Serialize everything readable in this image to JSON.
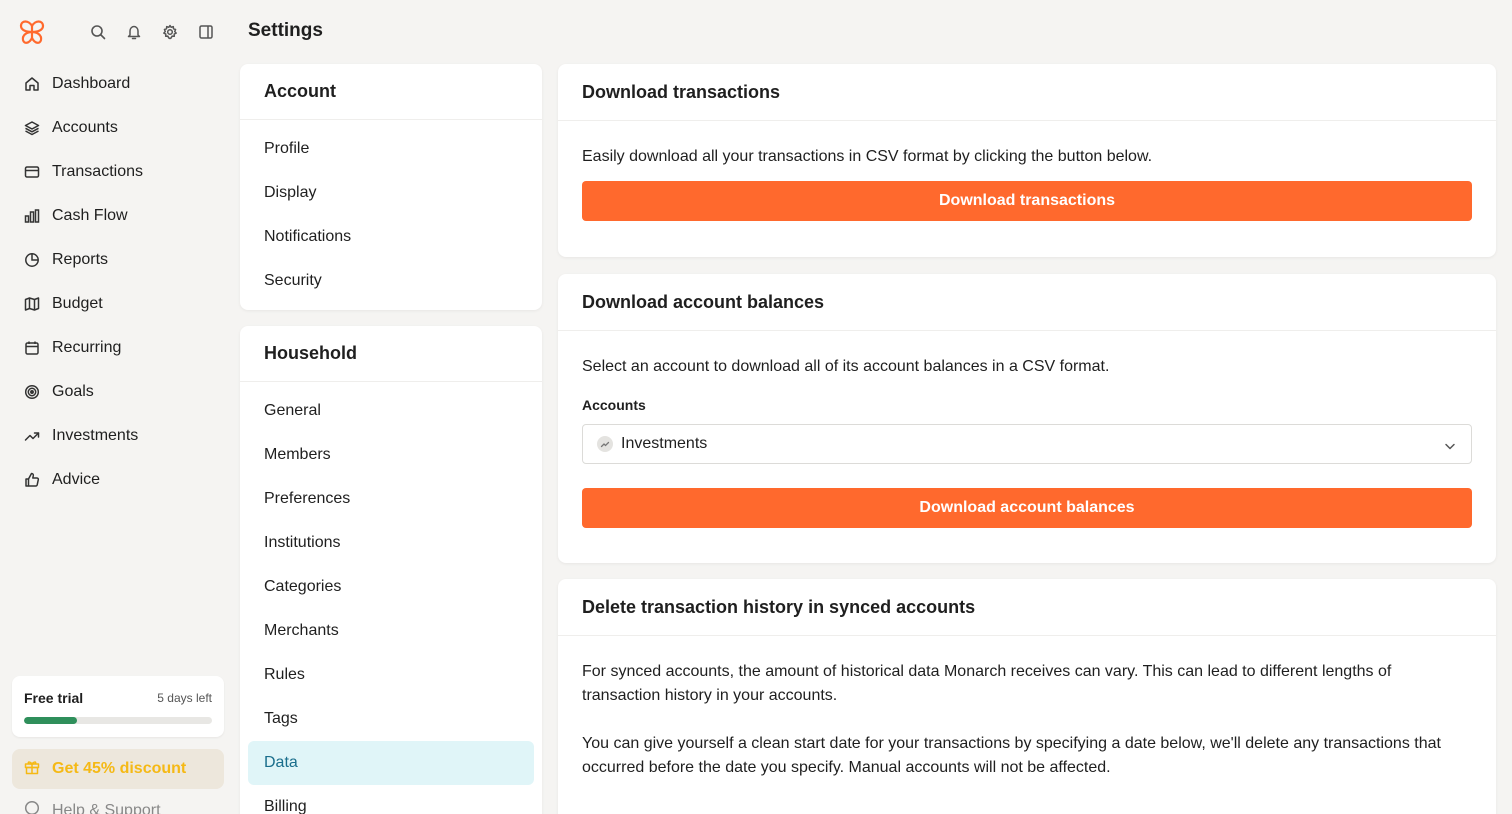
{
  "topbar": {
    "page_title": "Settings"
  },
  "sidebar": {
    "items": [
      {
        "label": "Dashboard",
        "icon": "home-icon"
      },
      {
        "label": "Accounts",
        "icon": "layers-icon"
      },
      {
        "label": "Transactions",
        "icon": "credit-card-icon"
      },
      {
        "label": "Cash Flow",
        "icon": "bar-chart-icon"
      },
      {
        "label": "Reports",
        "icon": "pie-chart-icon"
      },
      {
        "label": "Budget",
        "icon": "map-icon"
      },
      {
        "label": "Recurring",
        "icon": "calendar-icon"
      },
      {
        "label": "Goals",
        "icon": "target-icon"
      },
      {
        "label": "Investments",
        "icon": "trending-up-icon"
      },
      {
        "label": "Advice",
        "icon": "thumbs-up-icon"
      }
    ],
    "trial": {
      "label": "Free trial",
      "days_left": "5 days left",
      "progress": 0.28
    },
    "discount": {
      "label": "Get 45% discount"
    },
    "help": {
      "label": "Help & Support"
    }
  },
  "settings_menu": {
    "account": {
      "title": "Account",
      "items": [
        "Profile",
        "Display",
        "Notifications",
        "Security"
      ]
    },
    "household": {
      "title": "Household",
      "items": [
        "General",
        "Members",
        "Preferences",
        "Institutions",
        "Categories",
        "Merchants",
        "Rules",
        "Tags",
        "Data",
        "Billing"
      ],
      "active": "Data"
    }
  },
  "download_transactions": {
    "title": "Download transactions",
    "description": "Easily download all your transactions in CSV format by clicking the button below.",
    "button": "Download transactions"
  },
  "download_balances": {
    "title": "Download account balances",
    "description": "Select an account to download all of its account balances in a CSV format.",
    "field_label": "Accounts",
    "selected_account": "Investments",
    "button": "Download account balances"
  },
  "delete_history": {
    "title": "Delete transaction history in synced accounts",
    "paragraph1": "For synced accounts, the amount of historical data Monarch receives can vary. This can lead to different lengths of transaction history in your accounts.",
    "paragraph2": "You can give yourself a clean start date for your transactions by specifying a date below, we'll delete any transactions that occurred before the date you specify. Manual accounts will not be affected."
  },
  "colors": {
    "accent": "#ff692d",
    "active_bg": "#e0f5f8",
    "active_text": "#1a6e8c",
    "progress": "#2f8f5b",
    "discount_text": "#f5b915"
  }
}
